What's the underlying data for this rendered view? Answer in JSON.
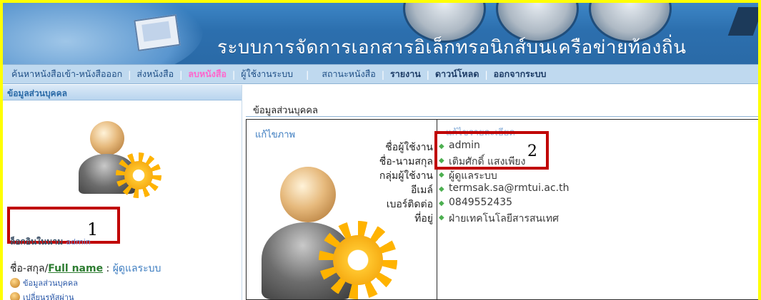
{
  "header": {
    "title": "ระบบการจัดการเอกสารอิเล็กทรอนิกส์บนเครือข่ายท้องถิ่น"
  },
  "nav": {
    "items": [
      {
        "label": "ค้นหาหนังสือเข้า-หนังสือออก"
      },
      {
        "label": "ส่งหนังสือ"
      },
      {
        "label": "ลบหนังสือ"
      },
      {
        "label": "ผู้ใช้งานระบบ"
      },
      {
        "label": "สถานะหนังสือ"
      },
      {
        "label": "รายงาน"
      },
      {
        "label": "ดาวน์โหลด"
      },
      {
        "label": "ออกจากระบบ"
      }
    ]
  },
  "sidebar": {
    "heading": "ข้อมูลส่วนบุคคล",
    "login_as_label": "ล็อกอินในนาม",
    "login_as_user": "admin",
    "fullname_prefix": "ชื่อ-สกุล/",
    "fullname_link": "Full name",
    "fullname_separator": " : ",
    "fullname_value": "ผู้ดูแลระบบ",
    "links": [
      {
        "label": "ข้อมูลส่วนบุคคล"
      },
      {
        "label": "เปลี่ยนรหัสผ่าน"
      }
    ]
  },
  "main": {
    "section_title": "ข้อมูลส่วนบุคคล",
    "edit_photo": "แก้ไขภาพ",
    "edit_detail": "แก้ไขรายละเอียด",
    "fields": [
      {
        "label": "ชื่อผู้ใช้งาน",
        "value": "admin"
      },
      {
        "label": "ชื่อ-นามสกุล",
        "value": "เติมศักดิ์ แสงเพียง"
      },
      {
        "label": "กลุ่มผู้ใช้งาน",
        "value": "ผู้ดูแลระบบ"
      },
      {
        "label": "อีเมล์",
        "value": "termsak.sa@rmtui.ac.th"
      },
      {
        "label": "เบอร์ติดต่อ",
        "value": "0849552435"
      },
      {
        "label": "ที่อยู่",
        "value": "ฝ่ายเทคโนโลยีสารสนเทศ"
      }
    ]
  },
  "annotations": {
    "box1_number": "1",
    "box2_number": "2"
  }
}
